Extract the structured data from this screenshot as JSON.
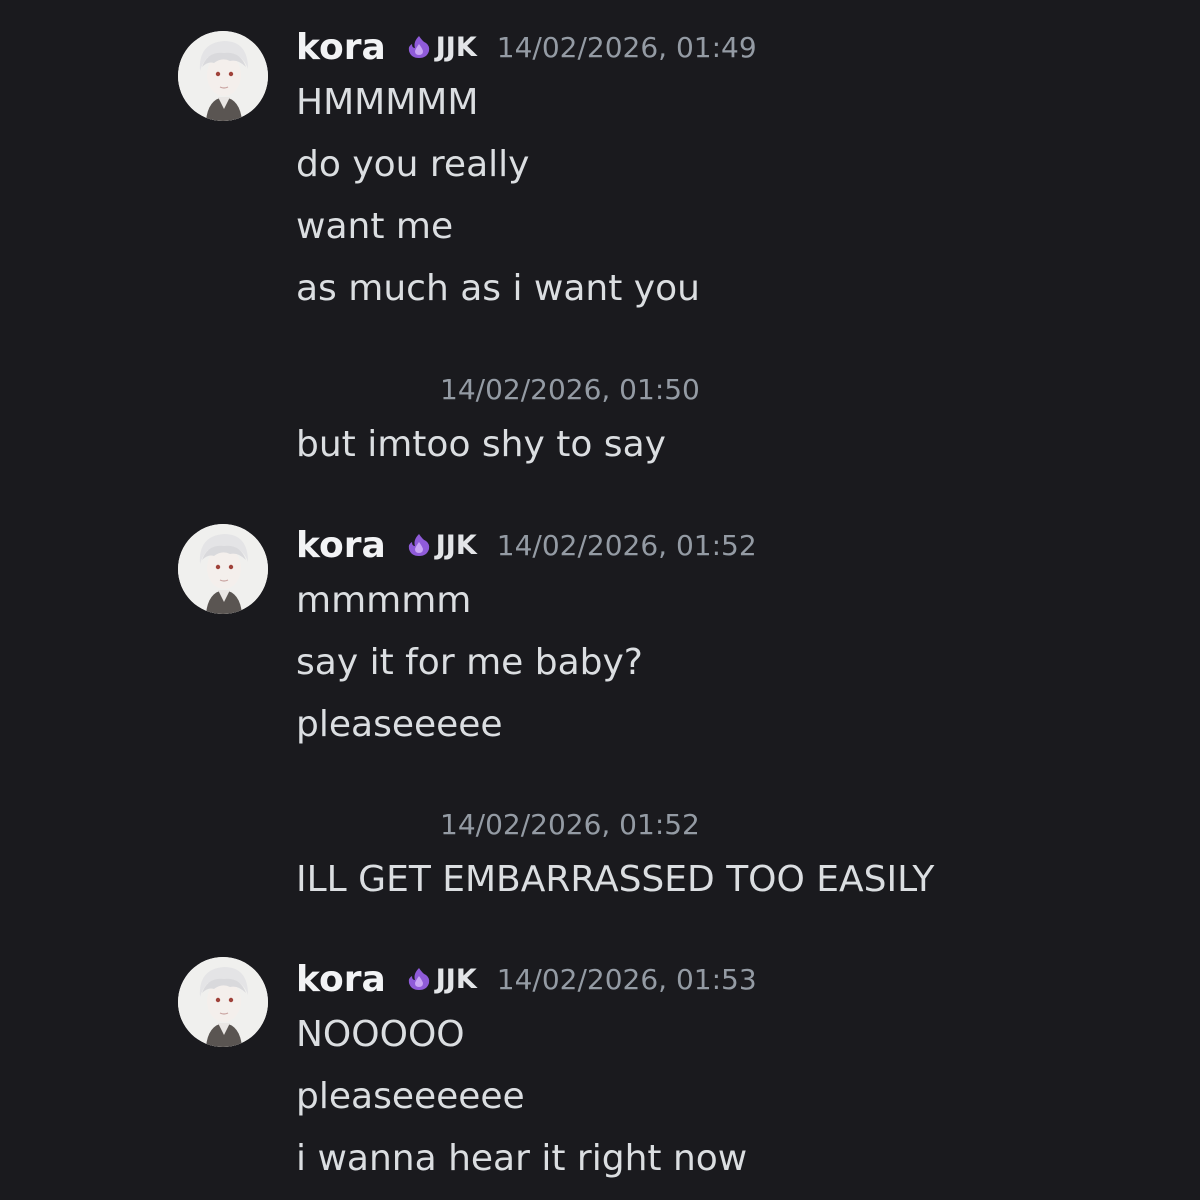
{
  "groups": [
    {
      "username": "kora",
      "tag_icon": "purple-flame-icon",
      "tag": "JJK",
      "timestamp": "14/02/2026, 01:49",
      "messages": [
        "HMMMMM",
        "do you really",
        "want me",
        "as much as i want you"
      ]
    },
    {
      "timestamp": "14/02/2026, 01:50",
      "messages": [
        "but imtoo shy to say"
      ]
    },
    {
      "username": "kora",
      "tag_icon": "purple-flame-icon",
      "tag": "JJK",
      "timestamp": "14/02/2026, 01:52",
      "messages": [
        "mmmmm",
        "say it for me baby?",
        "pleaseeeee"
      ]
    },
    {
      "timestamp": "14/02/2026, 01:52",
      "messages": [
        "ILL GET EMBARRASSED TOO EASILY"
      ]
    },
    {
      "username": "kora",
      "tag_icon": "purple-flame-icon",
      "tag": "JJK",
      "timestamp": "14/02/2026, 01:53",
      "messages": [
        "NOOOOO",
        "pleaseeeeee",
        "i wanna hear it right now"
      ]
    }
  ],
  "colors": {
    "background": "#1a1a1e",
    "username": "#f2f3f5",
    "message": "#dbdee1",
    "timestamp": "#949ba4",
    "tag_icon": "#8f5bd9"
  }
}
